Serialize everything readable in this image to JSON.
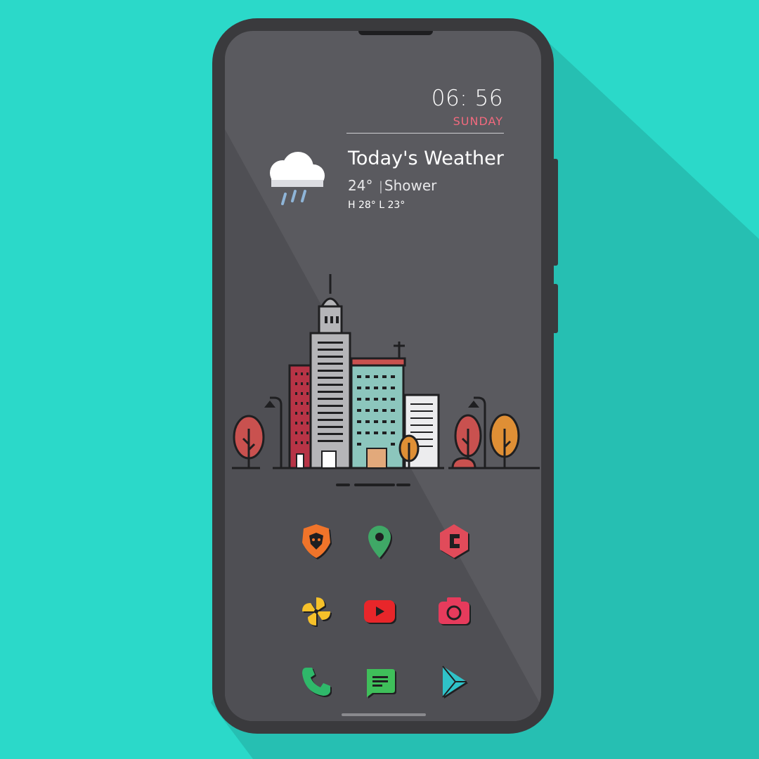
{
  "clock": {
    "time": "06: 56",
    "day": "SUNDAY"
  },
  "weather": {
    "title": "Today's Weather",
    "temperature": "24°",
    "separator": "|",
    "condition": "Shower",
    "high_low": "H 28°  L 23°",
    "icon": "rain-cloud-icon"
  },
  "apps": [
    {
      "name": "brave-icon"
    },
    {
      "name": "maps-icon"
    },
    {
      "name": "app-c-icon"
    },
    {
      "name": "pinwheel-icon"
    },
    {
      "name": "youtube-icon"
    },
    {
      "name": "camera-icon"
    },
    {
      "name": "phone-icon"
    },
    {
      "name": "messages-icon"
    },
    {
      "name": "play-store-icon"
    }
  ],
  "colors": {
    "background": "#2bd9c9",
    "phone_body": "#3a3a3d",
    "screen": "#5a5a5f",
    "day_accent": "#f26a7e"
  }
}
